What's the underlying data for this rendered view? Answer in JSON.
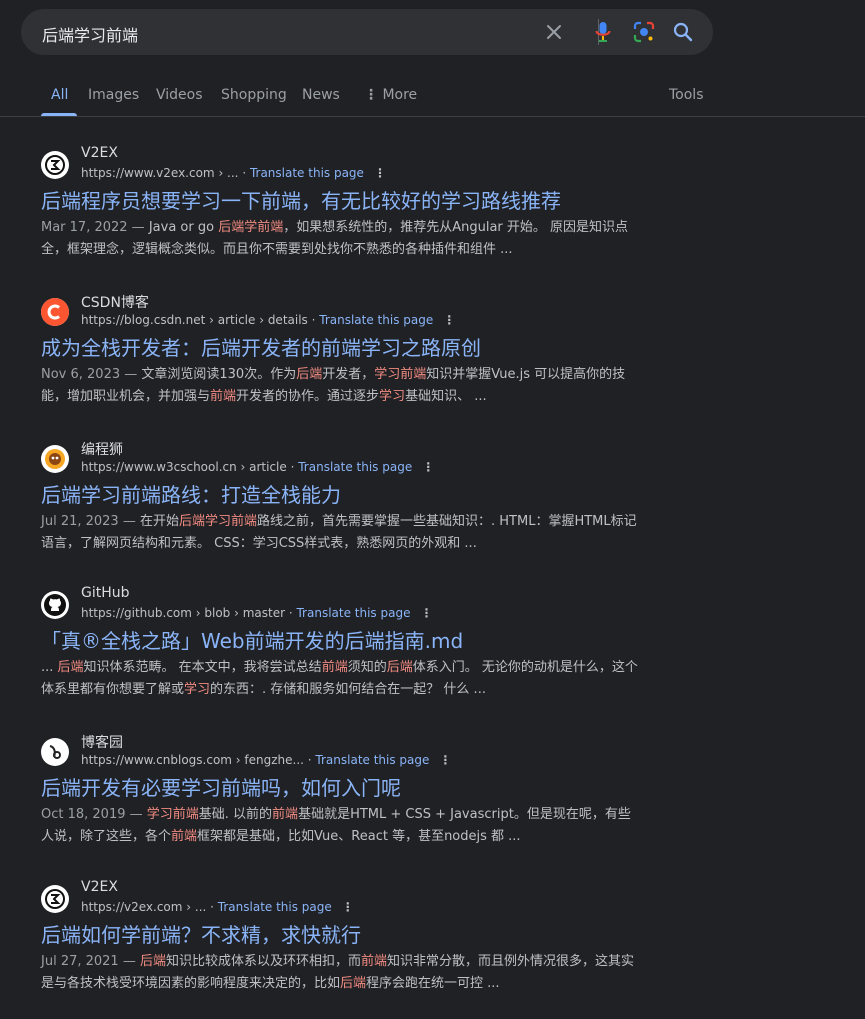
{
  "search": {
    "query": "后端学习前端"
  },
  "tabs": [
    {
      "label": "All"
    },
    {
      "label": "Images"
    },
    {
      "label": "Videos"
    },
    {
      "label": "Shopping"
    },
    {
      "label": "News"
    },
    {
      "label": "More"
    }
  ],
  "tools_label": "Tools",
  "translate_label": "Translate this page",
  "colors": {
    "background": "#202124",
    "link": "#8ab4f8",
    "highlight": "#f28b82"
  },
  "results": [
    {
      "site": "V2EX",
      "url": "https://www.v2ex.com › ...",
      "title": "后端程序员想要学习一下前端，有无比较好的学习路线推荐",
      "icon": "v2ex-icon",
      "snippet": [
        {
          "t": "Mar 17, 2022 — ",
          "c": "date"
        },
        {
          "t": "Java or go "
        },
        {
          "t": "后端学前端",
          "c": "hl"
        },
        {
          "t": "，如果想系统性的，推荐先从Angular 开始。 原因是知识点全，框架理念，逻辑概念类似。而且你不需要到处找你不熟悉的各种插件和组件 ..."
        }
      ]
    },
    {
      "site": "CSDN博客",
      "url": "https://blog.csdn.net › article › details",
      "title": "成为全栈开发者：后端开发者的前端学习之路原创",
      "icon": "csdn-icon",
      "snippet": [
        {
          "t": "Nov 6, 2023 — ",
          "c": "date"
        },
        {
          "t": "文章浏览阅读130次。作为"
        },
        {
          "t": "后端",
          "c": "hl"
        },
        {
          "t": "开发者，"
        },
        {
          "t": "学习前端",
          "c": "hl"
        },
        {
          "t": "知识并掌握Vue.js 可以提高你的技能，增加职业机会，并加强与"
        },
        {
          "t": "前端",
          "c": "hl"
        },
        {
          "t": "开发者的协作。通过逐步"
        },
        {
          "t": "学习",
          "c": "hl"
        },
        {
          "t": "基础知识、 ..."
        }
      ]
    },
    {
      "site": "编程狮",
      "url": "https://www.w3cschool.cn › article",
      "title": "后端学习前端路线：打造全栈能力",
      "icon": "w3cschool-icon",
      "snippet": [
        {
          "t": "Jul 21, 2023 — ",
          "c": "date"
        },
        {
          "t": "在开始"
        },
        {
          "t": "后端学习前端",
          "c": "hl"
        },
        {
          "t": "路线之前，首先需要掌握一些基础知识：. HTML：掌握HTML标记语言，了解网页结构和元素。 CSS：学习CSS样式表，熟悉网页的外观和 ..."
        }
      ]
    },
    {
      "site": "GitHub",
      "url": "https://github.com › blob › master",
      "title": "「真®全栈之路」Web前端开发的后端指南.md",
      "icon": "github-icon",
      "snippet": [
        {
          "t": "... "
        },
        {
          "t": "后端",
          "c": "hl"
        },
        {
          "t": "知识体系范畴。 在本文中，我将尝试总结"
        },
        {
          "t": "前端",
          "c": "hl"
        },
        {
          "t": "须知的"
        },
        {
          "t": "后端",
          "c": "hl"
        },
        {
          "t": "体系入门。 无论你的动机是什么，这个体系里都有你想要了解或"
        },
        {
          "t": "学习",
          "c": "hl"
        },
        {
          "t": "的东西：. 存储和服务如何结合在一起？ 什么 ..."
        }
      ]
    },
    {
      "site": "博客园",
      "url": "https://www.cnblogs.com › fengzhe...",
      "title": "后端开发有必要学习前端吗，如何入门呢",
      "icon": "cnblogs-icon",
      "snippet": [
        {
          "t": "Oct 18, 2019 — ",
          "c": "date"
        },
        {
          "t": "学习前端",
          "c": "hl"
        },
        {
          "t": "基础. 以前的"
        },
        {
          "t": "前端",
          "c": "hl"
        },
        {
          "t": "基础就是HTML + CSS + Javascript。但是现在呢，有些人说，除了这些，各个"
        },
        {
          "t": "前端",
          "c": "hl"
        },
        {
          "t": "框架都是基础，比如Vue、React 等，甚至nodejs 都 ..."
        }
      ]
    },
    {
      "site": "V2EX",
      "url": "https://v2ex.com › ...",
      "title": "后端如何学前端？不求精，求快就行",
      "icon": "v2ex-icon",
      "snippet": [
        {
          "t": "Jul 27, 2021 — ",
          "c": "date"
        },
        {
          "t": "后端",
          "c": "hl"
        },
        {
          "t": "知识比较成体系以及环环相扣，而"
        },
        {
          "t": "前端",
          "c": "hl"
        },
        {
          "t": "知识非常分散，而且例外情况很多，这其实是与各技术栈受环境因素的影响程度来决定的，比如"
        },
        {
          "t": "后端",
          "c": "hl"
        },
        {
          "t": "程序会跑在统一可控 ..."
        }
      ]
    }
  ]
}
